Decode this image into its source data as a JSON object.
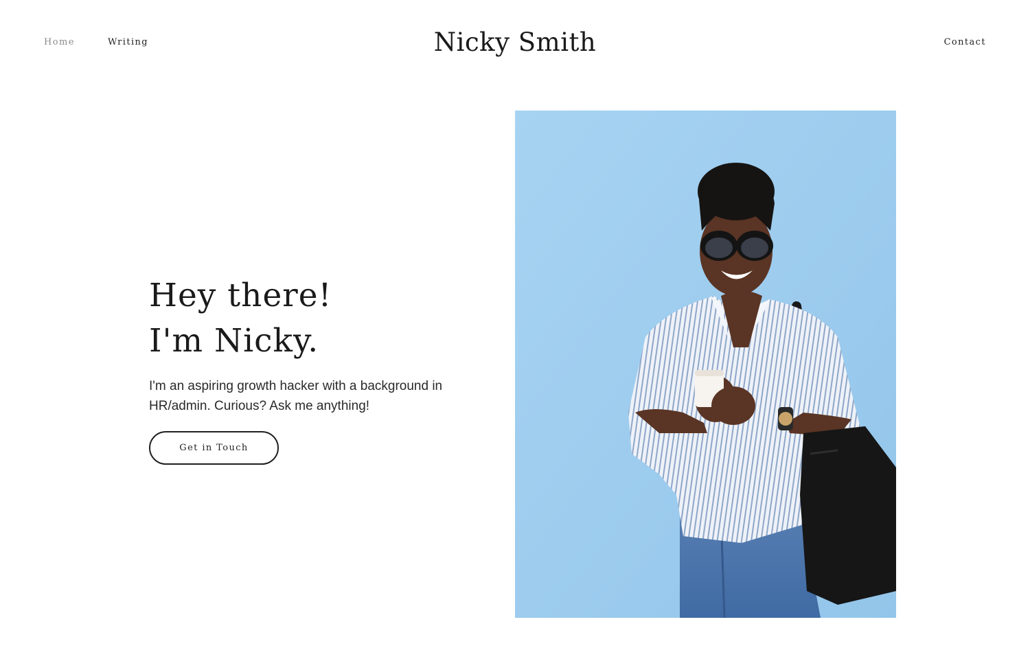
{
  "header": {
    "nav_left": [
      {
        "label": "Home"
      },
      {
        "label": "Writing"
      }
    ],
    "site_title": "Nicky Smith",
    "nav_right": {
      "label": "Contact"
    }
  },
  "hero": {
    "heading_line1": "Hey there!",
    "heading_line2": "I'm Nicky.",
    "intro": "I'm an aspiring growth hacker with a background in HR/admin. Curious? Ask me anything!",
    "cta_label": "Get in Touch"
  },
  "photo": {
    "background_color": "#9fcdee"
  }
}
